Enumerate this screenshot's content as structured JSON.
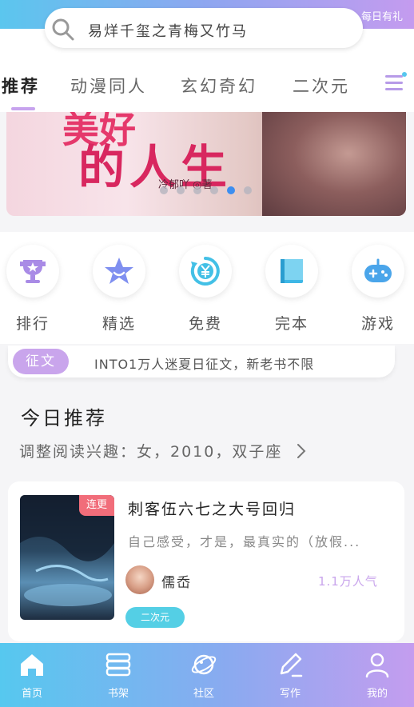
{
  "header": {
    "search_placeholder": "易烊千玺之青梅又竹马",
    "daily_gift": "每日有礼"
  },
  "tabs": [
    {
      "label": "推荐",
      "active": true
    },
    {
      "label": "动漫同人",
      "active": false
    },
    {
      "label": "玄幻奇幻",
      "active": false
    },
    {
      "label": "二次元",
      "active": false
    }
  ],
  "banner": {
    "title_line1": "美好",
    "title_line2": "的人生",
    "author": "冷郁吖 ◎著",
    "slide_count": 6,
    "active_slide": 5
  },
  "categories": [
    {
      "label": "排行",
      "icon": "trophy-icon"
    },
    {
      "label": "精选",
      "icon": "star-icon"
    },
    {
      "label": "免费",
      "icon": "yen-refresh-icon"
    },
    {
      "label": "完本",
      "icon": "book-icon"
    },
    {
      "label": "游戏",
      "icon": "gamepad-icon"
    }
  ],
  "notice": {
    "tag": "征文",
    "text": "INTO1万人迷夏日征文，新老书不限"
  },
  "today": {
    "title": "今日推荐",
    "subtitle": "调整阅读兴趣：女，2010，双子座"
  },
  "book": {
    "status_tag": "连更",
    "title": "刺客伍六七之大号回归",
    "description": "自己感受，才是，最真实的（放假...",
    "author": "儒岙",
    "popularity": "1.1万人气",
    "genre": "二次元"
  },
  "bottom_nav": [
    {
      "label": "首页",
      "icon": "home-icon"
    },
    {
      "label": "书架",
      "icon": "bookshelf-icon"
    },
    {
      "label": "社区",
      "icon": "planet-icon"
    },
    {
      "label": "写作",
      "icon": "pen-icon"
    },
    {
      "label": "我的",
      "icon": "user-icon"
    }
  ],
  "colors": {
    "accent_purple": "#c9a5ec",
    "accent_blue": "#56c8ef",
    "tag_red": "#f16d7a",
    "genre_cyan": "#54cfe5"
  }
}
